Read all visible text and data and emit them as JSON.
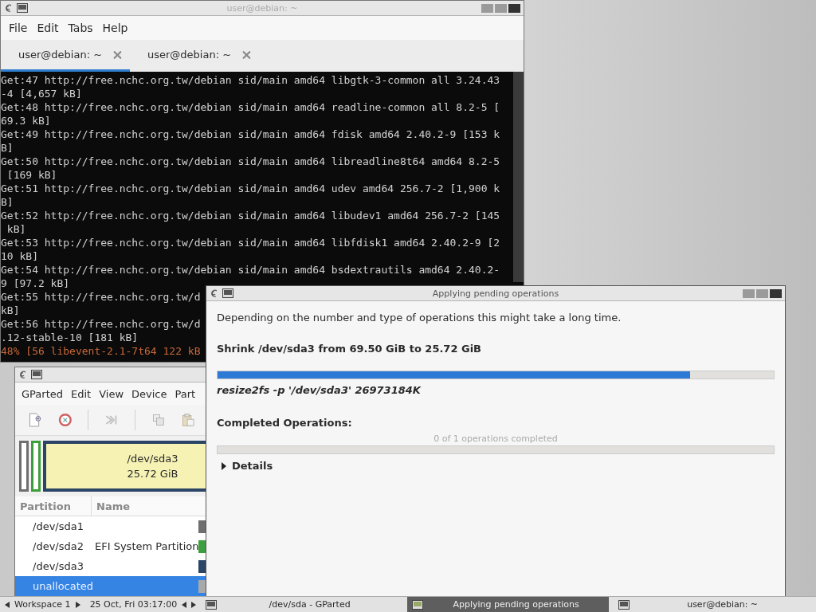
{
  "terminal": {
    "title": "user@debian: ~",
    "menu": [
      "File",
      "Edit",
      "Tabs",
      "Help"
    ],
    "tabs": [
      {
        "label": "user@debian: ~",
        "selected": true
      },
      {
        "label": "user@debian: ~",
        "selected": false
      }
    ],
    "lines": [
      {
        "kind": "output",
        "text": "Get:47 http://free.nchc.org.tw/debian sid/main amd64 libgtk-3-common all 3.24.43"
      },
      {
        "kind": "output",
        "text": "-4 [4,657 kB]"
      },
      {
        "kind": "output",
        "text": "Get:48 http://free.nchc.org.tw/debian sid/main amd64 readline-common all 8.2-5 ["
      },
      {
        "kind": "output",
        "text": "69.3 kB]"
      },
      {
        "kind": "output",
        "text": "Get:49 http://free.nchc.org.tw/debian sid/main amd64 fdisk amd64 2.40.2-9 [153 k"
      },
      {
        "kind": "output",
        "text": "B]"
      },
      {
        "kind": "output",
        "text": "Get:50 http://free.nchc.org.tw/debian sid/main amd64 libreadline8t64 amd64 8.2-5"
      },
      {
        "kind": "output",
        "text": " [169 kB]"
      },
      {
        "kind": "output",
        "text": "Get:51 http://free.nchc.org.tw/debian sid/main amd64 udev amd64 256.7-2 [1,900 k"
      },
      {
        "kind": "output",
        "text": "B]"
      },
      {
        "kind": "output",
        "text": "Get:52 http://free.nchc.org.tw/debian sid/main amd64 libudev1 amd64 256.7-2 [145"
      },
      {
        "kind": "output",
        "text": " kB]"
      },
      {
        "kind": "output",
        "text": "Get:53 http://free.nchc.org.tw/debian sid/main amd64 libfdisk1 amd64 2.40.2-9 [2"
      },
      {
        "kind": "output",
        "text": "10 kB]"
      },
      {
        "kind": "output",
        "text": "Get:54 http://free.nchc.org.tw/debian sid/main amd64 bsdextrautils amd64 2.40.2-"
      },
      {
        "kind": "output",
        "text": "9 [97.2 kB]"
      },
      {
        "kind": "output",
        "text": "Get:55 http://free.nchc.org.tw/d"
      },
      {
        "kind": "output",
        "text": "kB]"
      },
      {
        "kind": "output",
        "text": "Get:56 http://free.nchc.org.tw/d"
      },
      {
        "kind": "output",
        "text": ".12-stable-10 [181 kB]"
      },
      {
        "kind": "progress",
        "text": "48% [56 libevent-2.1-7t64 122 kB"
      }
    ]
  },
  "gparted": {
    "menu": [
      "GParted",
      "Edit",
      "View",
      "Device",
      "Part"
    ],
    "map": {
      "partition": "/dev/sda3",
      "size": "25.72 GiB"
    },
    "columns": [
      "Partition",
      "Name"
    ],
    "rows": [
      {
        "partition": "/dev/sda1",
        "color": "#6e6e6e",
        "selected": false
      },
      {
        "partition": "/dev/sda2",
        "name": "EFI System Partition",
        "color": "#3c9e3c",
        "selected": false
      },
      {
        "partition": "/dev/sda3",
        "color": "#2b4566",
        "selected": false
      },
      {
        "partition": "unallocated",
        "color": "#a9a9a9",
        "selected": true
      }
    ]
  },
  "dialog": {
    "title": "Applying pending operations",
    "intro": "Depending on the number and type of operations this might take a long time.",
    "operation": "Shrink /dev/sda3 from 69.50 GiB to 25.72 GiB",
    "progress": {
      "level": 0.85
    },
    "command": "resize2fs -p '/dev/sda3' 26973184K",
    "completed_label": "Completed Operations:",
    "completed": {
      "text": "0 of 1 operations completed",
      "level": 0
    },
    "details": {
      "label": "Details",
      "expanded": false
    }
  },
  "taskbar": {
    "workspace": "Workspace 1",
    "clock": "25 Oct, Fri 03:17:00",
    "tasks": [
      {
        "label": "/dev/sda - GParted",
        "selected": false
      },
      {
        "label": "Applying pending operations",
        "selected": true
      },
      {
        "label": "user@debian: ~",
        "selected": false
      }
    ]
  }
}
